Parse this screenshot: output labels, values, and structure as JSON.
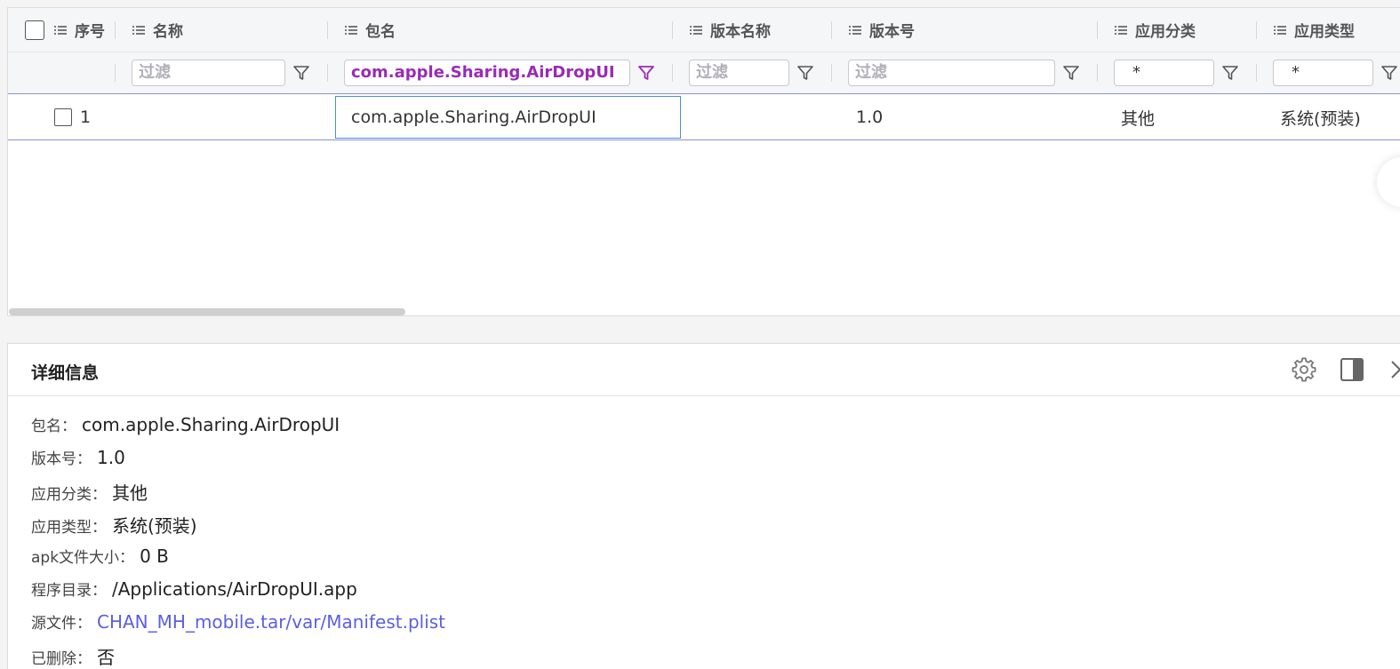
{
  "table": {
    "columns": [
      {
        "label": "序号"
      },
      {
        "label": "名称"
      },
      {
        "label": "包名"
      },
      {
        "label": "版本名称"
      },
      {
        "label": "版本号"
      },
      {
        "label": "应用分类"
      },
      {
        "label": "应用类型"
      }
    ],
    "filters": {
      "name": "过滤",
      "package": "com.apple.Sharing.AirDropUI",
      "version_name": "过滤",
      "version_code": "过滤",
      "category": "*",
      "type": "*"
    },
    "rows": [
      {
        "index": "1",
        "name": "",
        "package": "com.apple.Sharing.AirDropUI",
        "version_name": "",
        "version_code": "1.0",
        "category": "其他",
        "type": "系统(预装)"
      }
    ]
  },
  "detail": {
    "title": "详细信息",
    "fields": [
      {
        "key": "包名：",
        "value": "com.apple.Sharing.AirDropUI"
      },
      {
        "key": "版本号：",
        "value": "1.0"
      },
      {
        "key": "应用分类：",
        "value": "其他"
      },
      {
        "key": "应用类型：",
        "value": "系统(预装)"
      },
      {
        "key": "apk文件大小：",
        "value": "0 B"
      },
      {
        "key": "程序目录：",
        "value": "/Applications/AirDropUI.app"
      },
      {
        "key": "源文件：",
        "value": "CHAN_MH_mobile.tar/var/Manifest.plist"
      },
      {
        "key": "已删除：",
        "value": "否"
      }
    ]
  },
  "colors": {
    "accent": "#5b5fe0",
    "active_filter": "#9a2bb5",
    "focus": "#4a8de0"
  }
}
